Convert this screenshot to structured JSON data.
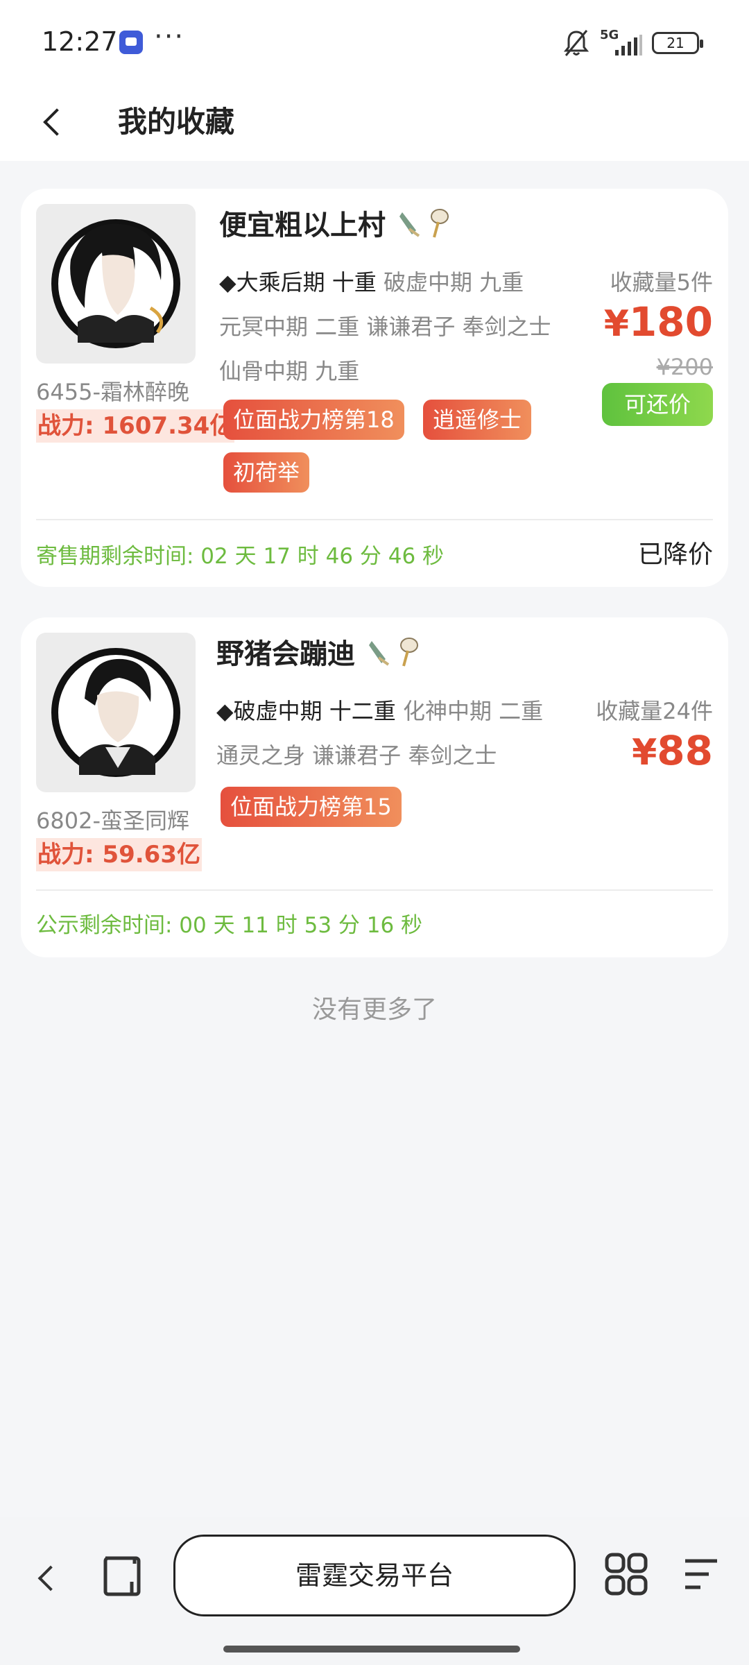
{
  "status_bar": {
    "time": "12:27",
    "network": "5G",
    "battery": "21"
  },
  "header": {
    "title": "我的收藏"
  },
  "items": [
    {
      "title": "便宜粗以上村",
      "server": "6455-霜林醉晚",
      "power_label": "战力:",
      "power_value": "1607.34亿",
      "realm_main": "◆大乘后期 十重",
      "realm_rest": " 破虚中期 九重",
      "realm_line2": "元冥中期 二重  谦谦君子  奉剑之士",
      "realm_line3": "仙骨中期 九重",
      "fav_count": "收藏量5件",
      "price_symbol": "¥",
      "price": "180",
      "old_price": "¥200",
      "bargain": "可还价",
      "tags": [
        "位面战力榜第18",
        "逍遥修士",
        "初荷举"
      ],
      "timer": "寄售期剩余时间:  02 天 17 时 46 分 46 秒",
      "discount_note": "已降价"
    },
    {
      "title": "野猪会蹦迪",
      "server": "6802-蛮圣同辉",
      "power_label": "战力:",
      "power_value": "59.63亿",
      "realm_main": "◆破虚中期 十二重",
      "realm_rest": " 化神中期 二重",
      "realm_line2": "通灵之身  谦谦君子  奉剑之士",
      "fav_count": "收藏量24件",
      "price_symbol": "¥",
      "price": "88",
      "tags": [
        "位面战力榜第15"
      ],
      "timer": "公示剩余时间:  00 天 11 时 53 分 16 秒"
    }
  ],
  "footer": {
    "no_more": "没有更多了"
  },
  "browser_bar": {
    "address": "雷霆交易平台"
  },
  "colors": {
    "price_red": "#e24a2f",
    "timer_green": "#6dbb3f",
    "bargain_green": "#5fc23e",
    "tag_gradient_start": "#e5503d",
    "tag_gradient_end": "#f08f5c"
  }
}
